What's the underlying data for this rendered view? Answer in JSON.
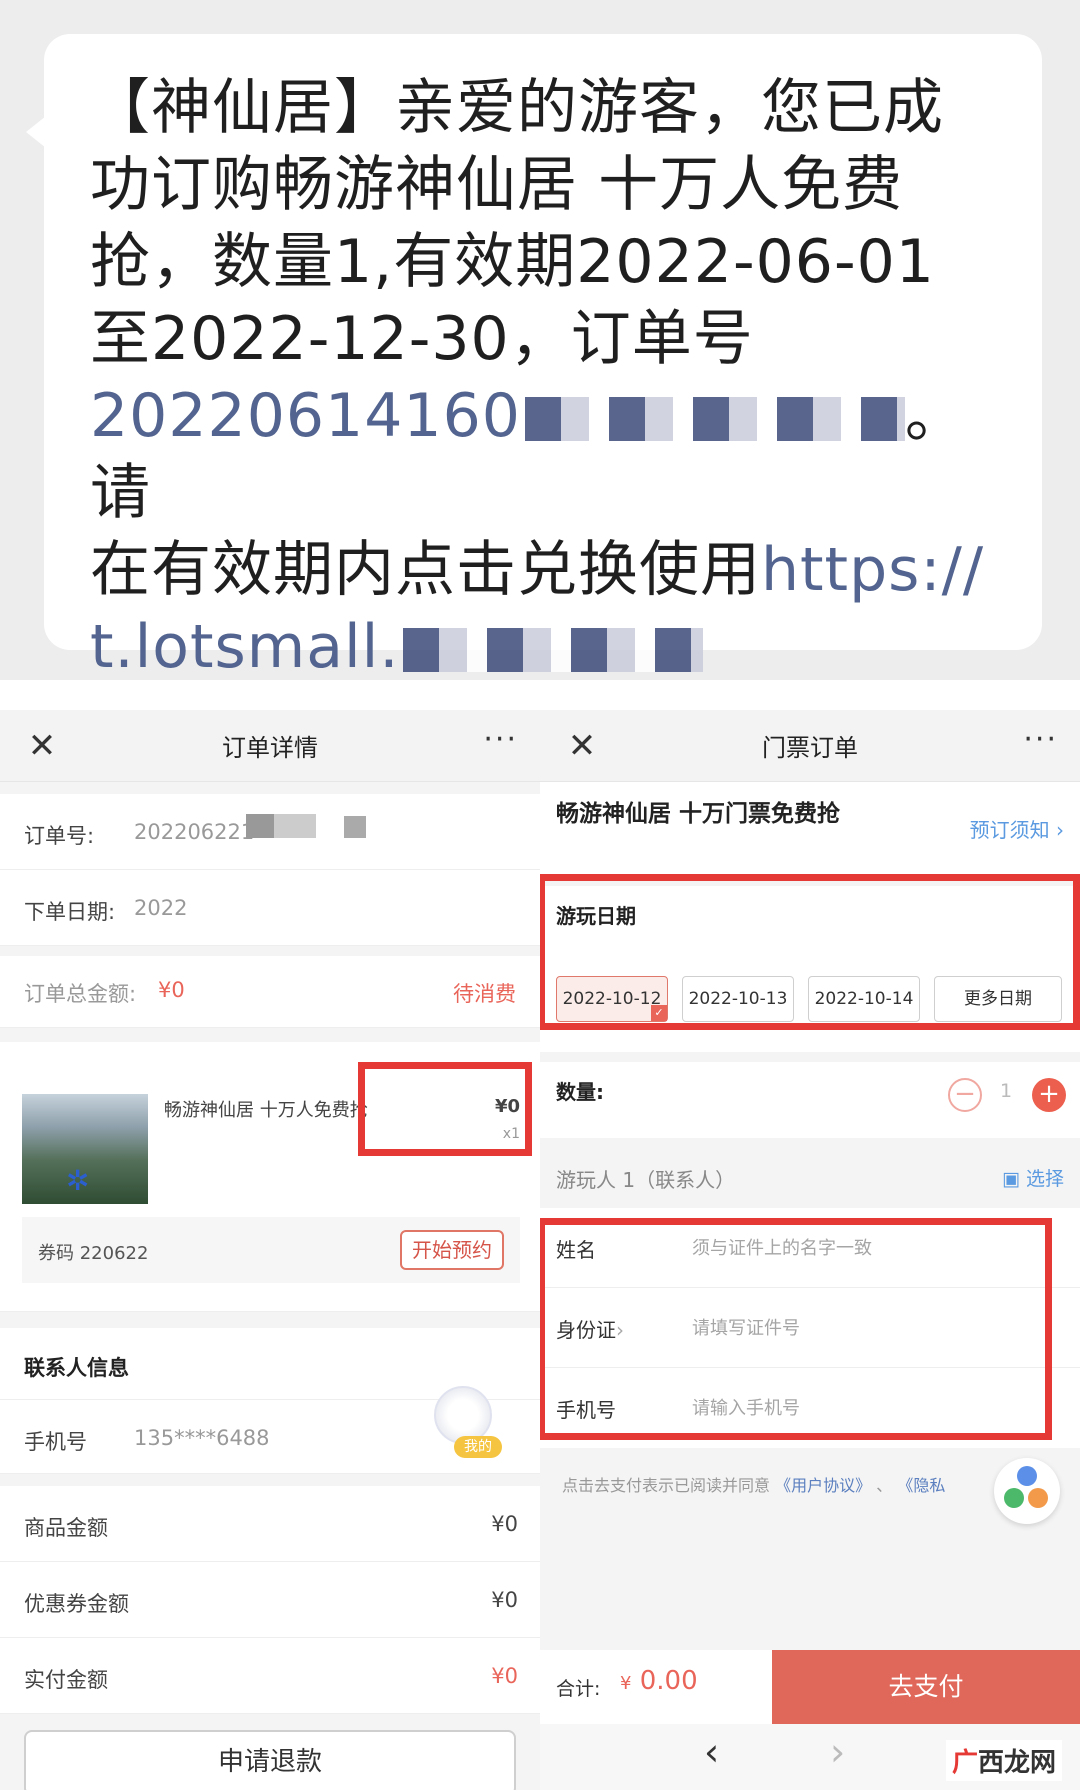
{
  "sms": {
    "brand": "【神仙居】",
    "line1_rest": "亲爱的游客，您已成",
    "line2": "功订购畅游神仙居 十万人免费",
    "line3": "抢，数量1,有效期2022-06-01",
    "line4": "至2022-12-30，订单号",
    "order_prefix": "20220614160",
    "after_order": "。请",
    "line6": "在有效期内点击兑换使用",
    "link_prefix": "https://",
    "link_domain": "t.lotsmall."
  },
  "left": {
    "title": "订单详情",
    "order_no_label": "订单号:",
    "order_no_value": "202206221",
    "order_date_label": "下单日期:",
    "order_date_value": "2022",
    "total_label": "订单总金额:",
    "total_value": "¥0",
    "status": "待消费",
    "product_name": "畅游神仙居 十万人免费抢",
    "product_price": "¥0",
    "product_qty": "x1",
    "voucher_label": "券码 220622",
    "reserve_btn": "开始预约",
    "contact_head": "联系人信息",
    "phone_label": "手机号",
    "phone_value": "135****6488",
    "me_badge": "我的",
    "goods_label": "商品金额",
    "goods_value": "¥0",
    "coupon_label": "优惠券金额",
    "coupon_value": "¥0",
    "paid_label": "实付金额",
    "paid_value": "¥0",
    "refund_btn": "申请退款"
  },
  "right": {
    "title": "门票订单",
    "product_title": "畅游神仙居 十万门票免费抢",
    "notice": "预订须知",
    "date_title": "游玩日期",
    "dates": [
      "2022-10-12",
      "2022-10-13",
      "2022-10-14",
      "更多日期"
    ],
    "qty_label": "数量:",
    "qty_value": "1",
    "visitor_head": "游玩人 1（联系人）",
    "select": "选择",
    "form": [
      {
        "label": "姓名",
        "placeholder": "须与证件上的名字一致"
      },
      {
        "label": "身份证",
        "placeholder": "请填写证件号"
      },
      {
        "label": "手机号",
        "placeholder": "请输入手机号"
      }
    ],
    "agree_prefix": "点击去支付表示已阅读并同意",
    "agree_link1": "《用户协议》",
    "agree_sep": "、",
    "agree_link2": "《隐私",
    "total_label": "合计:",
    "total_currency": "¥",
    "total_value": "0.00",
    "pay_btn": "去支付"
  },
  "watermark": {
    "g": "广",
    "rest": "西龙网"
  },
  "colors": {
    "accent_red": "#e9655a",
    "highlight": "#e53935",
    "link_blue": "#5b9ae0"
  }
}
